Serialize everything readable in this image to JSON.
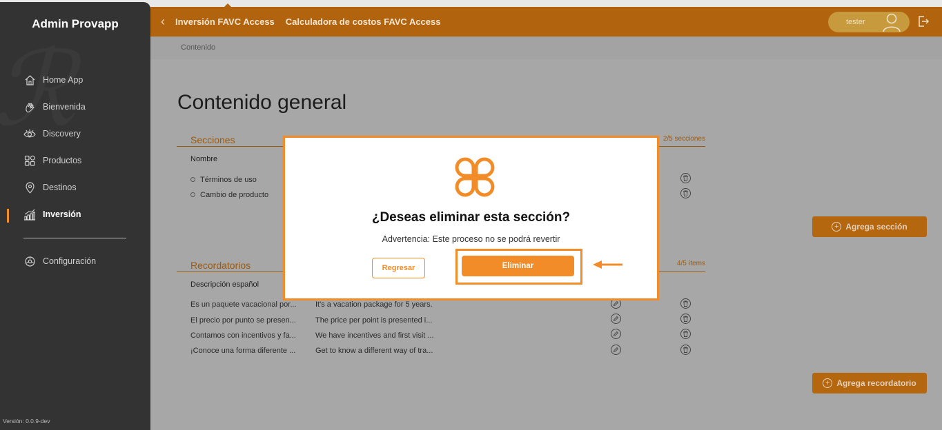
{
  "sidebar": {
    "title": "Admin Provapp",
    "items": [
      {
        "label": "Home App",
        "icon": "home-icon"
      },
      {
        "label": "Bienvenida",
        "icon": "wave-hand-icon"
      },
      {
        "label": "Discovery",
        "icon": "eye-icon"
      },
      {
        "label": "Productos",
        "icon": "grid-icon"
      },
      {
        "label": "Destinos",
        "icon": "location-pin-icon"
      },
      {
        "label": "Inversión",
        "icon": "bar-chart-icon",
        "active": true
      },
      {
        "label": "Configuración",
        "icon": "settings-icon"
      }
    ],
    "version": "Versión: 0.0.9-dev"
  },
  "topbar": {
    "crumbs": [
      "Inversión FAVC Access",
      "Calculadora de costos FAVC Access"
    ],
    "user": "tester"
  },
  "subbar": {
    "label": "Contenido"
  },
  "main": {
    "title": "Contenido general",
    "sections": {
      "label": "Secciones",
      "count": "2/5 secciones",
      "column": "Nombre",
      "rows": [
        "Términos de uso",
        "Cambio de producto"
      ],
      "add_label": "Agrega sección"
    },
    "reminders": {
      "label": "Recordatorios",
      "count": "4/5 ítems",
      "column": "Descripción español",
      "rows": [
        {
          "es": "Es un paquete vacacional por...",
          "en": "It's a vacation package for 5 years."
        },
        {
          "es": "El precio por punto se presen...",
          "en": "The price per point is presented i..."
        },
        {
          "es": "Contamos con incentivos y fa...",
          "en": "We have incentives and first visit ..."
        },
        {
          "es": "¡Conoce una forma diferente ...",
          "en": "Get to know a different way of tra..."
        }
      ],
      "add_label": "Agrega recordatorio"
    }
  },
  "modal": {
    "title": "¿Deseas eliminar esta sección?",
    "warning": "Advertencia: Este proceso no se podrá revertir",
    "back_label": "Regresar",
    "delete_label": "Eliminar"
  },
  "colors": {
    "accent": "#f28c28",
    "sidebar": "#333333",
    "topbar_dimmed": "#b1640d"
  }
}
